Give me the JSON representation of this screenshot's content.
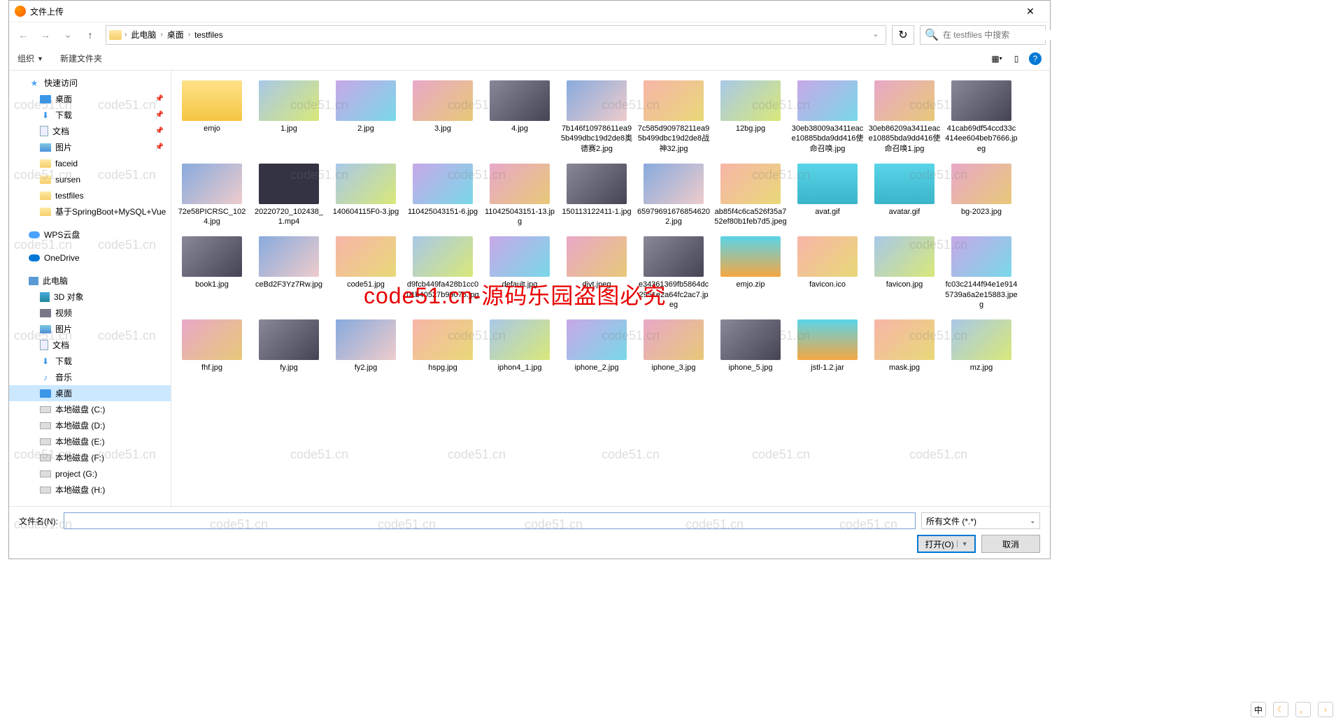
{
  "title": "文件上传",
  "breadcrumb": [
    "此电脑",
    "桌面",
    "testfiles"
  ],
  "search_placeholder": "在 testfiles 中搜索",
  "toolbar": {
    "organize": "组织",
    "newfolder": "新建文件夹"
  },
  "sidebar": {
    "quick": "快速访问",
    "desktop": "桌面",
    "downloads": "下载",
    "documents": "文档",
    "pictures": "图片",
    "faceid": "faceid",
    "sursen": "sursen",
    "testfiles": "testfiles",
    "springboot": "基于SpringBoot+MySQL+Vue",
    "wps": "WPS云盘",
    "onedrive": "OneDrive",
    "thispc": "此电脑",
    "obj3d": "3D 对象",
    "videos": "视频",
    "pics2": "图片",
    "docs2": "文档",
    "downloads2": "下载",
    "music": "音乐",
    "desktop2": "桌面",
    "diskC": "本地磁盘 (C:)",
    "diskD": "本地磁盘 (D:)",
    "diskE": "本地磁盘 (E:)",
    "diskF": "本地磁盘 (F:)",
    "projectG": "project (G:)",
    "diskH": "本地磁盘 (H:)"
  },
  "files": [
    {
      "n": "emjo",
      "t": "folder"
    },
    {
      "n": "1.jpg"
    },
    {
      "n": "2.jpg"
    },
    {
      "n": "3.jpg"
    },
    {
      "n": "4.jpg"
    },
    {
      "n": "7b146f10978611ea95b499dbc19d2de8奥德赛2.jpg"
    },
    {
      "n": "7c585d90978211ea95b499dbc19d2de8战神32.jpg"
    },
    {
      "n": "12bg.jpg"
    },
    {
      "n": "30eb38009a3411eace10885bda9dd416使命召唤.jpg"
    },
    {
      "n": "30eb86209a3411eace10885bda9dd416使命召唤1.jpg"
    },
    {
      "n": "41cab69df54ccd33c414ee604beb7666.jpeg"
    },
    {
      "n": "72e58PICRSC_1024.jpg"
    },
    {
      "n": "20220720_102438_1.mp4",
      "t": "video"
    },
    {
      "n": "140604115F0-3.jpg"
    },
    {
      "n": "110425043151-6.jpg"
    },
    {
      "n": "110425043151-13.jpg"
    },
    {
      "n": "150113122411-1.jpg"
    },
    {
      "n": "659796916768546202.jpg"
    },
    {
      "n": "ab85f4c6ca526f35a752ef80b1feb7d5.jpeg"
    },
    {
      "n": "avat.gif",
      "t": "gif"
    },
    {
      "n": "avatar.gif",
      "t": "gif"
    },
    {
      "n": "bg-2023.jpg"
    },
    {
      "n": "book1.jpg"
    },
    {
      "n": "ceBd2F3Yz7Rw.jpg"
    },
    {
      "n": "code51.jpg"
    },
    {
      "n": "d9fcb449fa428b1cc001b40527b99076.jpg"
    },
    {
      "n": "default.jpg"
    },
    {
      "n": "djyt.jpeg"
    },
    {
      "n": "e34361369fb5864dc2951e2a64fc2ac7.jpeg"
    },
    {
      "n": "emjo.zip",
      "t": "zip"
    },
    {
      "n": "favicon.ico"
    },
    {
      "n": "favicon.jpg"
    },
    {
      "n": "fc03c2144f94e1e9145739a6a2e15883.jpeg"
    },
    {
      "n": "fhf.jpg"
    },
    {
      "n": "fy.jpg"
    },
    {
      "n": "fy2.jpg"
    },
    {
      "n": "hspg.jpg"
    },
    {
      "n": "iphon4_1.jpg"
    },
    {
      "n": "iphone_2.jpg"
    },
    {
      "n": "iphone_3.jpg"
    },
    {
      "n": "iphone_5.jpg"
    },
    {
      "n": "jstl-1.2.jar",
      "t": "zip"
    },
    {
      "n": "mask.jpg"
    },
    {
      "n": "mz.jpg"
    }
  ],
  "footer": {
    "fn_label": "文件名(N):",
    "filter": "所有文件 (*.*)",
    "open": "打开(O)",
    "cancel": "取消"
  },
  "watermark": "code51.cn",
  "watermark_red": "code51.cn-源码乐园盗图必究",
  "ime": "中"
}
